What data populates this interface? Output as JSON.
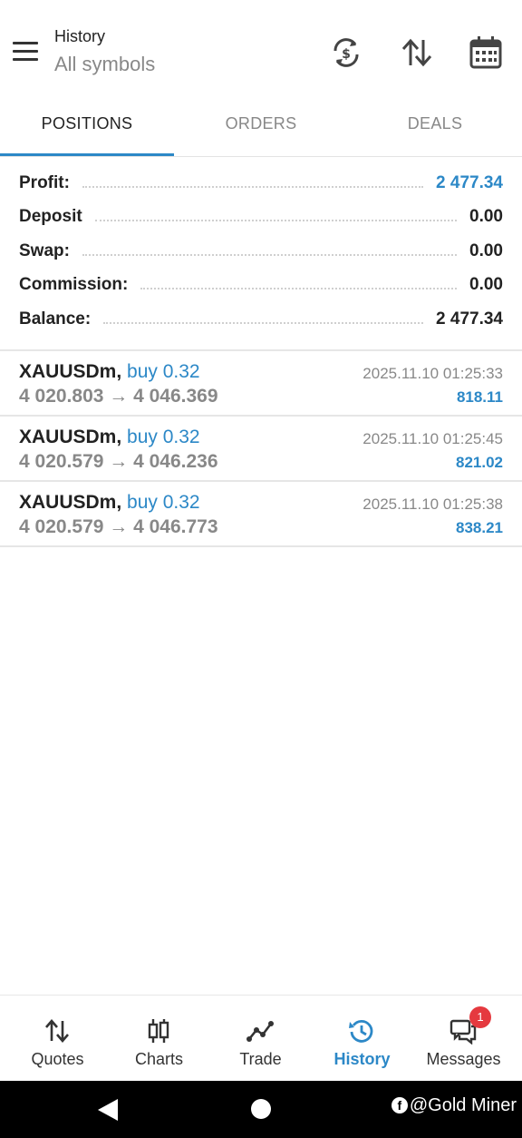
{
  "header": {
    "title": "History",
    "subtitle": "All symbols",
    "icons": [
      "exchange-dollar-icon",
      "sort-icon",
      "calendar-icon"
    ]
  },
  "tabs": [
    {
      "label": "POSITIONS",
      "active": true
    },
    {
      "label": "ORDERS",
      "active": false
    },
    {
      "label": "DEALS",
      "active": false
    }
  ],
  "summary": [
    {
      "label": "Profit:",
      "value": "2 477.34",
      "highlight": true
    },
    {
      "label": "Deposit",
      "value": "0.00"
    },
    {
      "label": "Swap:",
      "value": "0.00"
    },
    {
      "label": "Commission:",
      "value": "0.00"
    },
    {
      "label": "Balance:",
      "value": "2 477.34"
    }
  ],
  "positions": [
    {
      "symbol": "XAUUSDm,",
      "side": "buy 0.32",
      "prices": "4 020.803 → 4 046.369",
      "time": "2025.11.10 01:25:33",
      "profit": "818.11"
    },
    {
      "symbol": "XAUUSDm,",
      "side": "buy 0.32",
      "prices": "4 020.579 → 4 046.236",
      "time": "2025.11.10 01:25:45",
      "profit": "821.02"
    },
    {
      "symbol": "XAUUSDm,",
      "side": "buy 0.32",
      "prices": "4 020.579 → 4 046.773",
      "time": "2025.11.10 01:25:38",
      "profit": "838.21"
    }
  ],
  "nav": [
    {
      "label": "Quotes",
      "icon": "quotes-icon"
    },
    {
      "label": "Charts",
      "icon": "charts-icon"
    },
    {
      "label": "Trade",
      "icon": "trade-icon"
    },
    {
      "label": "History",
      "icon": "history-icon",
      "active": true
    },
    {
      "label": "Messages",
      "icon": "messages-icon",
      "badge": "1"
    }
  ],
  "watermark": "@Gold Miner",
  "colors": {
    "accent": "#2c88c7",
    "badge": "#e5393f",
    "muted": "#888888"
  }
}
